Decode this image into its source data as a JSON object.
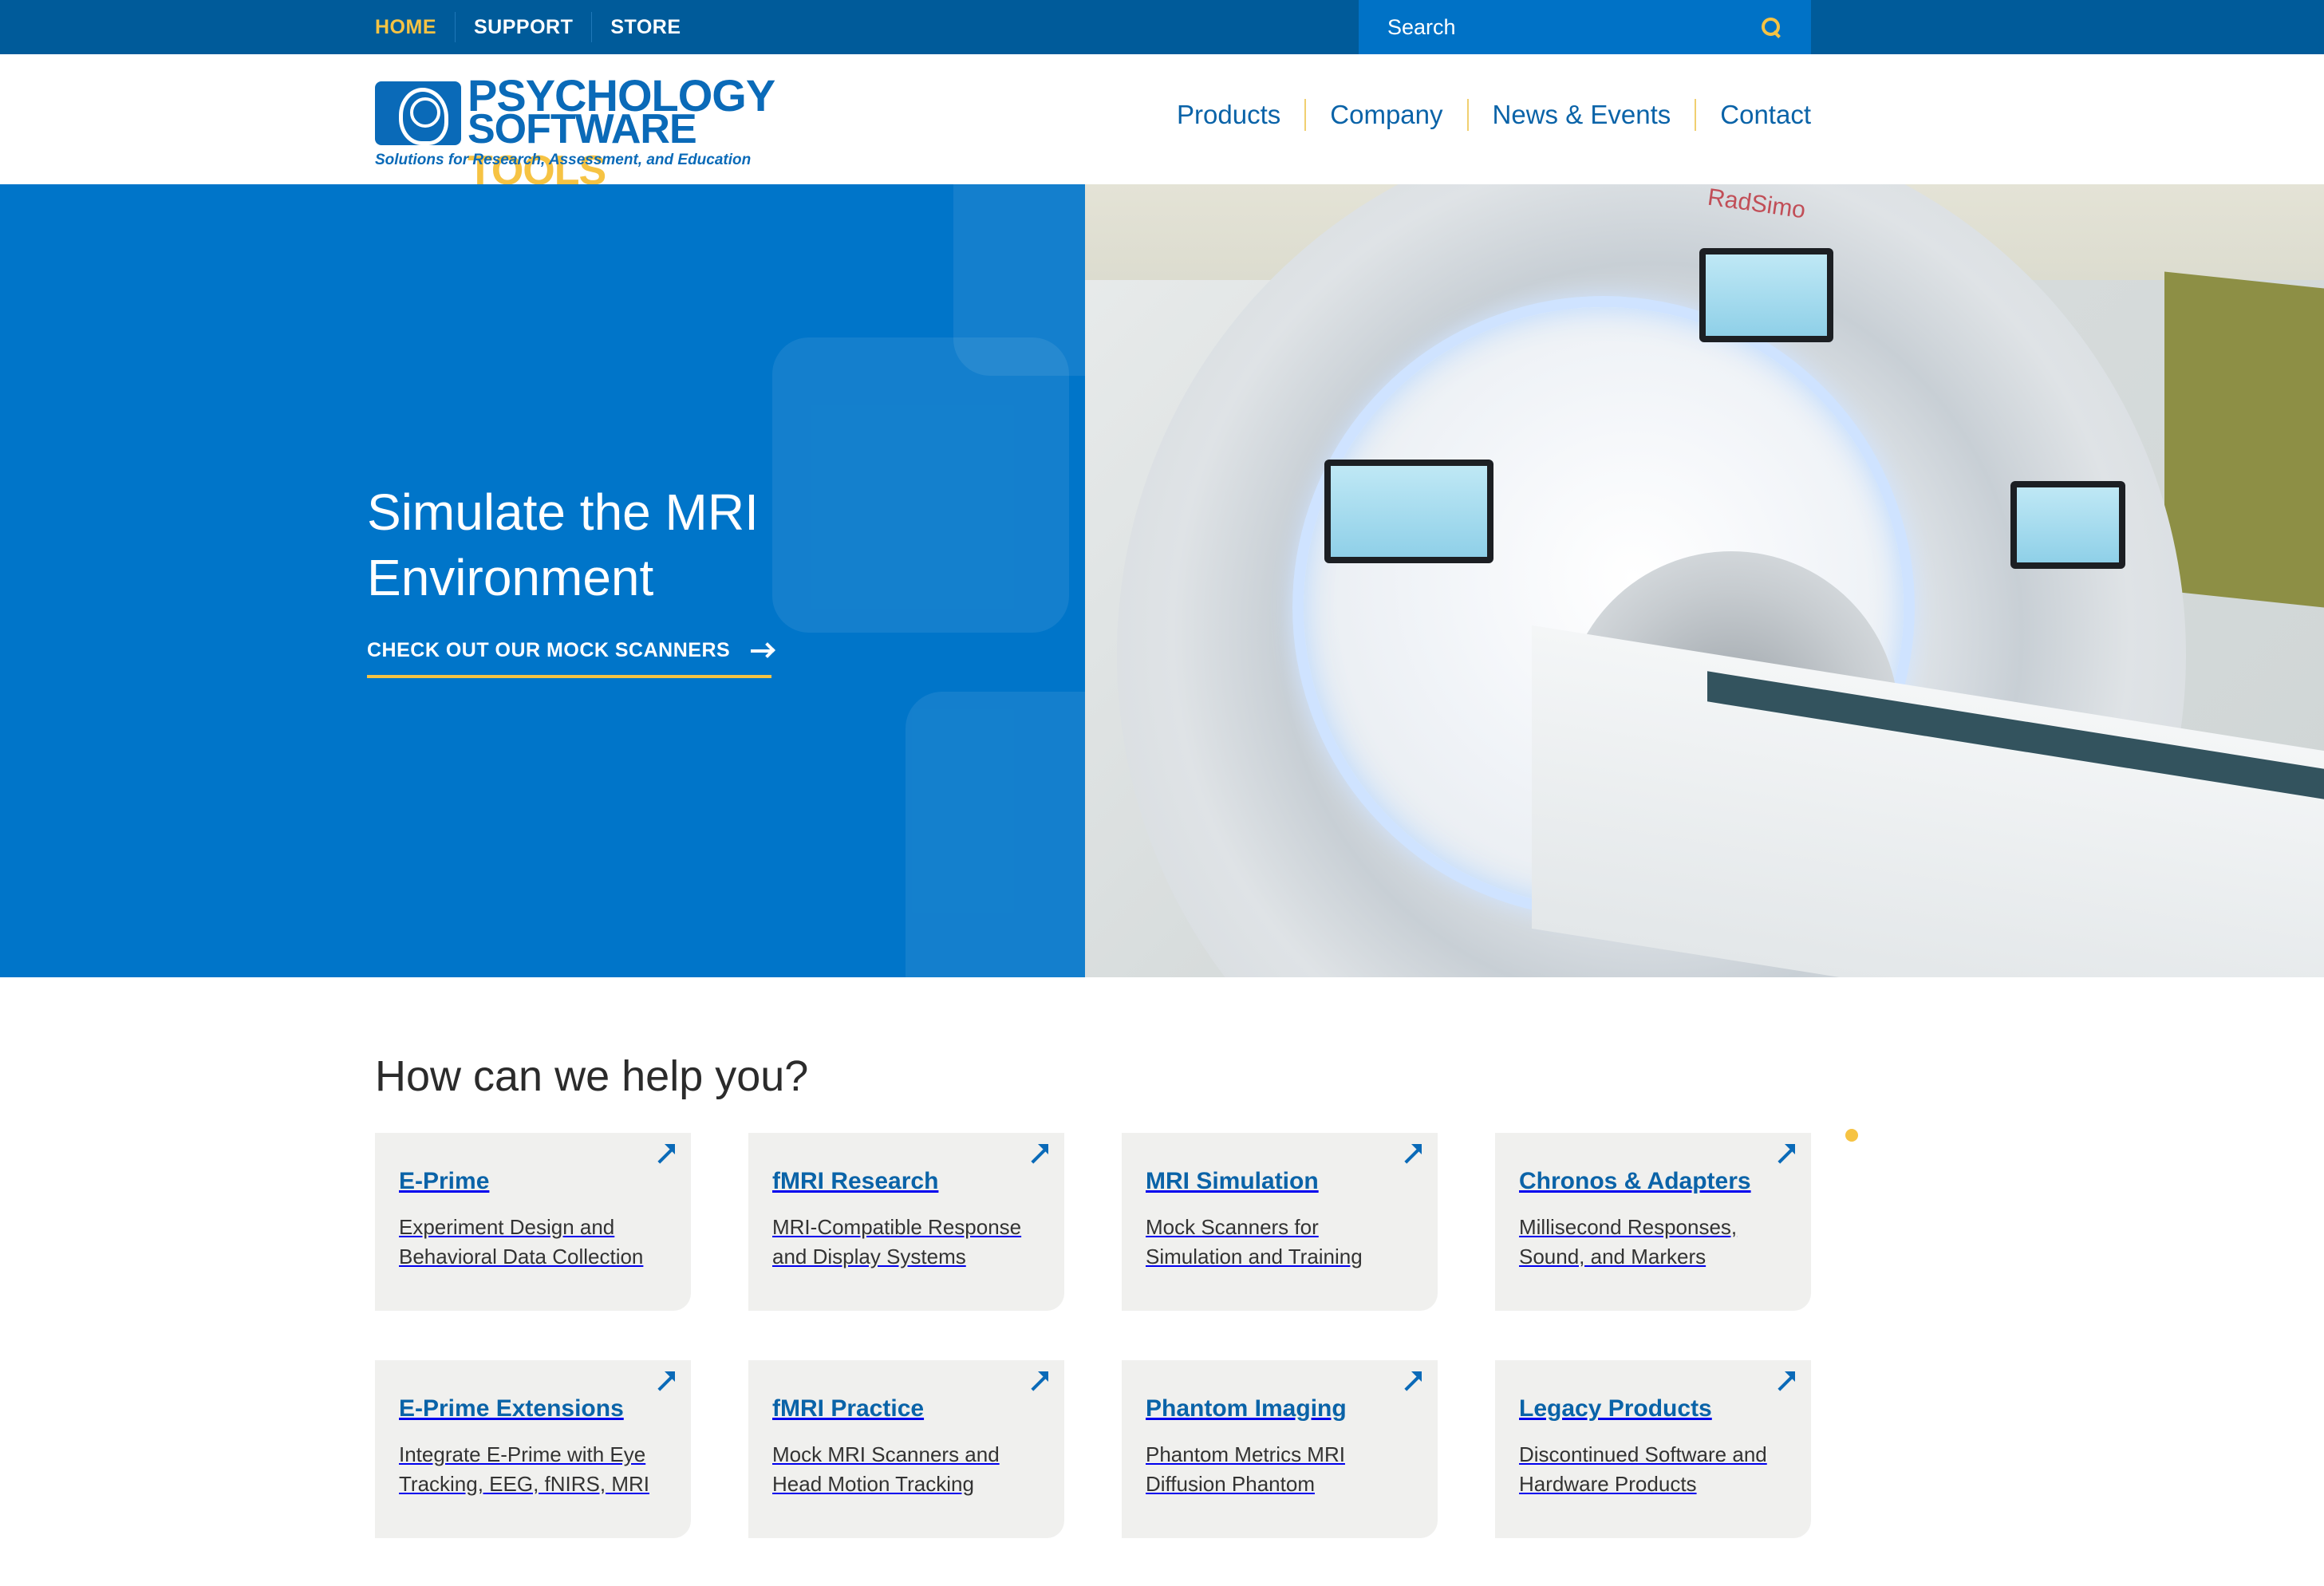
{
  "topnav": {
    "items": [
      {
        "label": "HOME",
        "active": true
      },
      {
        "label": "SUPPORT",
        "active": false
      },
      {
        "label": "STORE",
        "active": false
      }
    ],
    "search_placeholder": "Search"
  },
  "logo": {
    "line1": "PSYCHOLOGY",
    "line2_a": "SOFTWARE",
    "line2_b": "TOOLS",
    "tagline": "Solutions for Research, Assessment, and Education"
  },
  "mainnav": {
    "items": [
      "Products",
      "Company",
      "News & Events",
      "Contact"
    ]
  },
  "hero": {
    "title_line1": "Simulate the MRI",
    "title_line2": "Environment",
    "cta": "CHECK OUT OUR MOCK SCANNERS",
    "image_brand": "RadSimo",
    "slides": 5,
    "active_slide": 3
  },
  "help": {
    "title": "How can we help you?",
    "cards": [
      {
        "title": "E-Prime",
        "desc1": "Experiment Design and",
        "desc2": "Behavioral Data Collection"
      },
      {
        "title": "fMRI Research",
        "desc1": "MRI-Compatible Response",
        "desc2": "and Display Systems"
      },
      {
        "title": "MRI Simulation",
        "desc1": "Mock Scanners for",
        "desc2": "Simulation and Training"
      },
      {
        "title": "Chronos & Adapters",
        "desc1": "Millisecond Responses,",
        "desc2": "Sound, and Markers"
      },
      {
        "title": "E-Prime Extensions",
        "desc1": "Integrate E-Prime with Eye",
        "desc2": "Tracking, EEG, fNIRS, MRI"
      },
      {
        "title": "fMRI Practice",
        "desc1": "Mock MRI Scanners and",
        "desc2": "Head Motion Tracking"
      },
      {
        "title": "Phantom Imaging",
        "desc1": "Phantom Metrics MRI",
        "desc2": "Diffusion Phantom"
      },
      {
        "title": "Legacy Products",
        "desc1": "Discontinued Software and",
        "desc2": "Hardware Products"
      }
    ]
  },
  "colors": {
    "topbar": "#005b9a",
    "accent_yellow": "#f6c343",
    "hero_blue": "#0075c9",
    "link_blue": "#0a63a8",
    "card_bg": "#f0f0ee"
  }
}
